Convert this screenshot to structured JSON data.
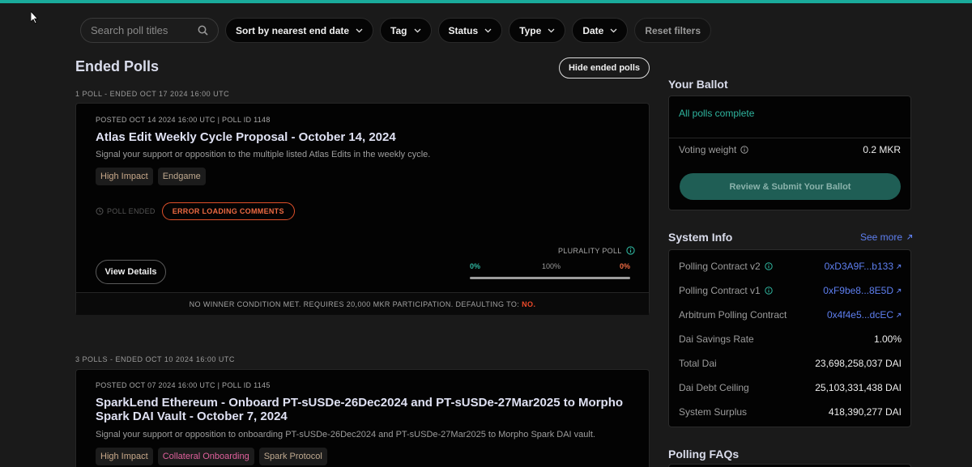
{
  "filters": {
    "search_placeholder": "Search poll titles",
    "sort_label": "Sort by nearest end date",
    "tag_label": "Tag",
    "status_label": "Status",
    "type_label": "Type",
    "date_label": "Date",
    "reset_label": "Reset filters"
  },
  "main": {
    "title": "Ended Polls",
    "hide_button": "Hide ended polls",
    "groups": [
      {
        "label": "1 POLL - ENDED OCT 17 2024 16:00 UTC",
        "poll": {
          "meta": "POSTED OCT 14 2024 16:00 UTC | POLL ID 1148",
          "title": "Atlas Edit Weekly Cycle Proposal - October 14, 2024",
          "description": "Signal your support or opposition to the multiple listed Atlas Edits in the weekly cycle.",
          "tags": [
            "High Impact",
            "Endgame"
          ],
          "ended_label": "POLL ENDED",
          "error_label": "ERROR LOADING COMMENTS",
          "view_button": "View Details",
          "poll_type": "PLURALITY POLL",
          "result_left": "0%",
          "result_mid": "100%",
          "result_right": "0%",
          "progress_fraction": 0,
          "footer_note": "NO WINNER CONDITION MET. REQUIRES 20,000 MKR PARTICIPATION. DEFAULTING TO:",
          "footer_default": "NO."
        }
      },
      {
        "label": "3 POLLS - ENDED OCT 10 2024 16:00 UTC",
        "poll": {
          "meta": "POSTED OCT 07 2024 16:00 UTC | POLL ID 1145",
          "title_line1": "SparkLend Ethereum - Onboard PT-sUSDe-26Dec2024 and PT-sUSDe-27Mar2025 to Morpho",
          "title_line2": "Spark DAI Vault - October 7, 2024",
          "description": "Signal your support or opposition to onboarding PT-sUSDe-26Dec2024 and PT-sUSDe-27Mar2025 to Morpho Spark DAI vault.",
          "tags": [
            "High Impact",
            "Collateral Onboarding",
            "Spark Protocol"
          ]
        }
      }
    ]
  },
  "ballot": {
    "title": "Your Ballot",
    "status": "All polls complete",
    "weight_label": "Voting weight",
    "weight_value": "0.2 MKR",
    "submit_button": "Review & Submit Your Ballot"
  },
  "system_info": {
    "title": "System Info",
    "see_more": "See more",
    "rows": [
      {
        "key": "Polling Contract v2",
        "value": "0xD3A9F...b133"
      },
      {
        "key": "Polling Contract v1",
        "value": "0xF9be8...8E5D"
      },
      {
        "key": "Arbitrum Polling Contract",
        "value": "0x4f4e5...dcEC"
      },
      {
        "key": "Dai Savings Rate",
        "value": "1.00%"
      },
      {
        "key": "Total Dai",
        "value": "23,698,258,037 DAI"
      },
      {
        "key": "Dai Debt Ceiling",
        "value": "25,103,331,438 DAI"
      },
      {
        "key": "System Surplus",
        "value": "418,390,277 DAI"
      }
    ]
  },
  "faq": {
    "title": "Polling FAQs"
  },
  "colors": {
    "accent": "#1aab9b",
    "link": "#5e7ff0",
    "error": "#ee6a42"
  }
}
